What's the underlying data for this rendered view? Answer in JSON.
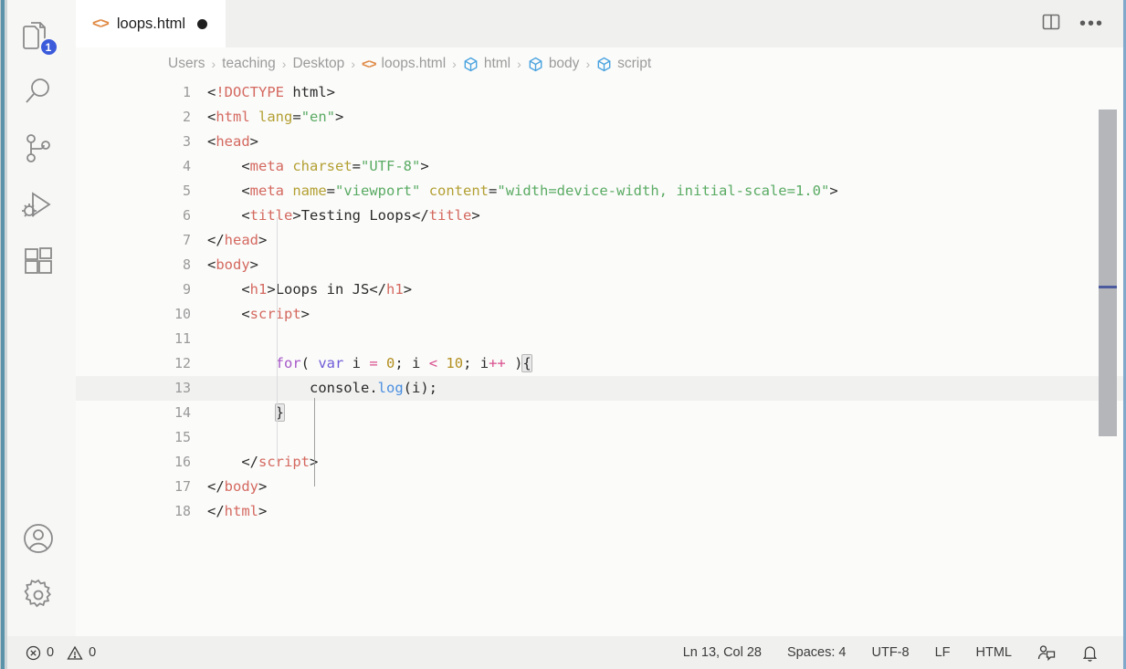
{
  "window": {
    "accent_color": "#5b93ab",
    "editor_bg": "#fbfbfa",
    "chrome_bg": "#f0f0ef"
  },
  "activitybar": {
    "items": [
      {
        "name": "explorer",
        "icon": "files-icon",
        "badge": "1"
      },
      {
        "name": "search",
        "icon": "search-icon",
        "badge": ""
      },
      {
        "name": "source-control",
        "icon": "source-control-icon",
        "badge": ""
      },
      {
        "name": "run-and-debug",
        "icon": "run-debug-icon",
        "badge": ""
      },
      {
        "name": "extensions",
        "icon": "extensions-icon",
        "badge": ""
      }
    ],
    "bottom_items": [
      {
        "name": "accounts",
        "icon": "account-icon"
      },
      {
        "name": "manage",
        "icon": "gear-icon"
      }
    ]
  },
  "tabbar": {
    "tab": {
      "icon": "html-file-icon",
      "icon_glyph": "<>",
      "label": "loops.html",
      "dirty": true
    },
    "actions": [
      {
        "name": "split-editor-right",
        "icon": "split-editor-icon"
      },
      {
        "name": "more-actions",
        "icon": "ellipsis-icon",
        "glyph": "•••"
      }
    ]
  },
  "breadcrumb": {
    "separator": "›",
    "items": [
      {
        "label": "Users",
        "icon": ""
      },
      {
        "label": "teaching",
        "icon": ""
      },
      {
        "label": "Desktop",
        "icon": ""
      },
      {
        "label": "loops.html",
        "icon": "html-file-icon"
      },
      {
        "label": "html",
        "icon": "symbol-cube-icon"
      },
      {
        "label": "body",
        "icon": "symbol-cube-icon"
      },
      {
        "label": "script",
        "icon": "symbol-cube-icon"
      }
    ]
  },
  "editor": {
    "language": "HTML",
    "active_line": 13,
    "lines": [
      {
        "n": "1",
        "tokens": [
          {
            "t": "punct",
            "v": "<"
          },
          {
            "t": "doctype",
            "v": "!DOCTYPE"
          },
          {
            "t": "text",
            "v": " html"
          },
          {
            "t": "punct",
            "v": ">"
          }
        ]
      },
      {
        "n": "2",
        "tokens": [
          {
            "t": "punct",
            "v": "<"
          },
          {
            "t": "tag",
            "v": "html"
          },
          {
            "t": "text",
            "v": " "
          },
          {
            "t": "attr",
            "v": "lang"
          },
          {
            "t": "punct",
            "v": "="
          },
          {
            "t": "string",
            "v": "\"en\""
          },
          {
            "t": "punct",
            "v": ">"
          }
        ]
      },
      {
        "n": "3",
        "tokens": [
          {
            "t": "punct",
            "v": "<"
          },
          {
            "t": "tag",
            "v": "head"
          },
          {
            "t": "punct",
            "v": ">"
          }
        ]
      },
      {
        "n": "4",
        "tokens": [
          {
            "t": "text",
            "v": "    "
          },
          {
            "t": "punct",
            "v": "<"
          },
          {
            "t": "tag",
            "v": "meta"
          },
          {
            "t": "text",
            "v": " "
          },
          {
            "t": "attr",
            "v": "charset"
          },
          {
            "t": "punct",
            "v": "="
          },
          {
            "t": "string",
            "v": "\"UTF-8\""
          },
          {
            "t": "punct",
            "v": ">"
          }
        ]
      },
      {
        "n": "5",
        "tokens": [
          {
            "t": "text",
            "v": "    "
          },
          {
            "t": "punct",
            "v": "<"
          },
          {
            "t": "tag",
            "v": "meta"
          },
          {
            "t": "text",
            "v": " "
          },
          {
            "t": "attr",
            "v": "name"
          },
          {
            "t": "punct",
            "v": "="
          },
          {
            "t": "string",
            "v": "\"viewport\""
          },
          {
            "t": "text",
            "v": " "
          },
          {
            "t": "attr",
            "v": "content"
          },
          {
            "t": "punct",
            "v": "="
          },
          {
            "t": "string",
            "v": "\"width=device-width, initial-scale=1.0\""
          },
          {
            "t": "punct",
            "v": ">"
          }
        ]
      },
      {
        "n": "6",
        "tokens": [
          {
            "t": "text",
            "v": "    "
          },
          {
            "t": "punct",
            "v": "<"
          },
          {
            "t": "tag",
            "v": "title"
          },
          {
            "t": "punct",
            "v": ">"
          },
          {
            "t": "text",
            "v": "Testing Loops"
          },
          {
            "t": "punct",
            "v": "</"
          },
          {
            "t": "tag",
            "v": "title"
          },
          {
            "t": "punct",
            "v": ">"
          }
        ]
      },
      {
        "n": "7",
        "tokens": [
          {
            "t": "punct",
            "v": "</"
          },
          {
            "t": "tag",
            "v": "head"
          },
          {
            "t": "punct",
            "v": ">"
          }
        ]
      },
      {
        "n": "8",
        "tokens": [
          {
            "t": "punct",
            "v": "<"
          },
          {
            "t": "tag",
            "v": "body"
          },
          {
            "t": "punct",
            "v": ">"
          }
        ]
      },
      {
        "n": "9",
        "tokens": [
          {
            "t": "text",
            "v": "    "
          },
          {
            "t": "punct",
            "v": "<"
          },
          {
            "t": "tag",
            "v": "h1"
          },
          {
            "t": "punct",
            "v": ">"
          },
          {
            "t": "text",
            "v": "Loops in JS"
          },
          {
            "t": "punct",
            "v": "</"
          },
          {
            "t": "tag",
            "v": "h1"
          },
          {
            "t": "punct",
            "v": ">"
          }
        ]
      },
      {
        "n": "10",
        "tokens": [
          {
            "t": "text",
            "v": "    "
          },
          {
            "t": "punct",
            "v": "<"
          },
          {
            "t": "tag",
            "v": "script"
          },
          {
            "t": "punct",
            "v": ">"
          }
        ]
      },
      {
        "n": "11",
        "tokens": []
      },
      {
        "n": "12",
        "tokens": [
          {
            "t": "text",
            "v": "        "
          },
          {
            "t": "kw",
            "v": "for"
          },
          {
            "t": "punct",
            "v": "( "
          },
          {
            "t": "var",
            "v": "var"
          },
          {
            "t": "ident",
            "v": " i "
          },
          {
            "t": "op",
            "v": "="
          },
          {
            "t": "ident",
            "v": " "
          },
          {
            "t": "num",
            "v": "0"
          },
          {
            "t": "punct",
            "v": "; "
          },
          {
            "t": "ident",
            "v": "i "
          },
          {
            "t": "op",
            "v": "<"
          },
          {
            "t": "ident",
            "v": " "
          },
          {
            "t": "num",
            "v": "10"
          },
          {
            "t": "punct",
            "v": "; "
          },
          {
            "t": "ident",
            "v": "i"
          },
          {
            "t": "op",
            "v": "++"
          },
          {
            "t": "punct",
            "v": " )"
          },
          {
            "t": "bracket",
            "v": "{"
          }
        ]
      },
      {
        "n": "13",
        "tokens": [
          {
            "t": "text",
            "v": "            "
          },
          {
            "t": "ident",
            "v": "console"
          },
          {
            "t": "punct",
            "v": "."
          },
          {
            "t": "fn",
            "v": "log"
          },
          {
            "t": "punct",
            "v": "("
          },
          {
            "t": "ident",
            "v": "i"
          },
          {
            "t": "punct",
            "v": ");"
          }
        ]
      },
      {
        "n": "14",
        "tokens": [
          {
            "t": "text",
            "v": "        "
          },
          {
            "t": "bracket",
            "v": "}"
          }
        ]
      },
      {
        "n": "15",
        "tokens": []
      },
      {
        "n": "16",
        "tokens": [
          {
            "t": "text",
            "v": "    "
          },
          {
            "t": "punct",
            "v": "</"
          },
          {
            "t": "tag",
            "v": "script"
          },
          {
            "t": "punct",
            "v": ">"
          }
        ]
      },
      {
        "n": "17",
        "tokens": [
          {
            "t": "punct",
            "v": "</"
          },
          {
            "t": "tag",
            "v": "body"
          },
          {
            "t": "punct",
            "v": ">"
          }
        ]
      },
      {
        "n": "18",
        "tokens": [
          {
            "t": "punct",
            "v": "</"
          },
          {
            "t": "tag",
            "v": "html"
          },
          {
            "t": "punct",
            "v": ">"
          }
        ]
      }
    ]
  },
  "statusbar": {
    "errors": "0",
    "warnings": "0",
    "position": "Ln 13, Col 28",
    "indentation": "Spaces: 4",
    "encoding": "UTF-8",
    "eol": "LF",
    "language": "HTML",
    "feedback_icon": "feedback-person-icon",
    "notifications_icon": "bell-icon"
  }
}
